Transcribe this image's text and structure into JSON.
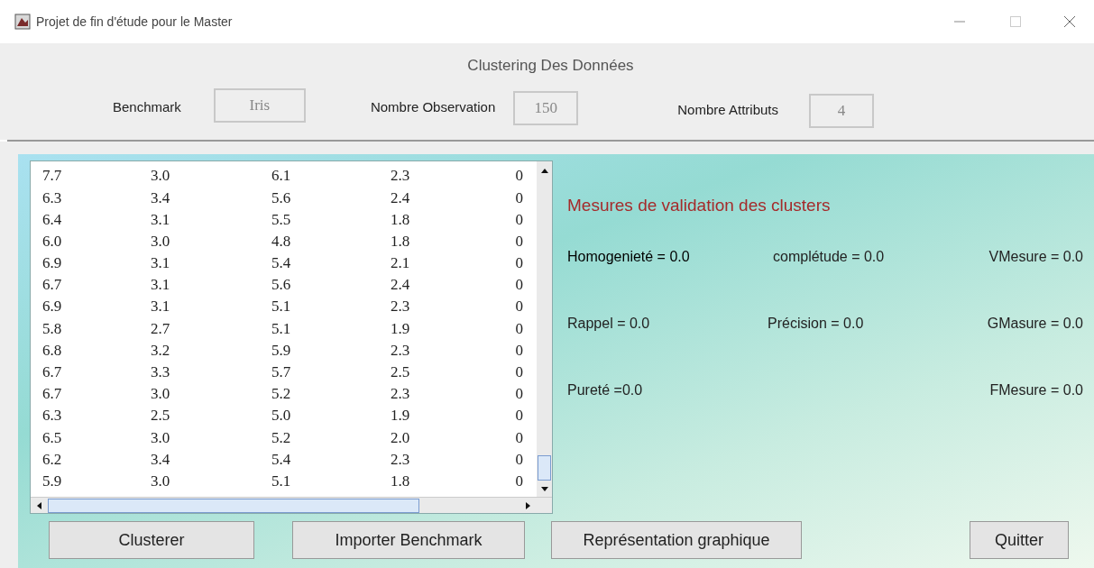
{
  "window": {
    "title": "Projet de fin d'étude pour le Master"
  },
  "header": {
    "title": "Clustering Des Données",
    "fields": [
      {
        "label": "Benchmark",
        "value": "Iris"
      },
      {
        "label": "Nombre Observation",
        "value": "150"
      },
      {
        "label": "Nombre Attributs",
        "value": "4"
      }
    ]
  },
  "table": {
    "rows": [
      [
        "7.7",
        "3.0",
        "6.1",
        "2.3",
        "0"
      ],
      [
        "6.3",
        "3.4",
        "5.6",
        "2.4",
        "0"
      ],
      [
        "6.4",
        "3.1",
        "5.5",
        "1.8",
        "0"
      ],
      [
        "6.0",
        "3.0",
        "4.8",
        "1.8",
        "0"
      ],
      [
        "6.9",
        "3.1",
        "5.4",
        "2.1",
        "0"
      ],
      [
        "6.7",
        "3.1",
        "5.6",
        "2.4",
        "0"
      ],
      [
        "6.9",
        "3.1",
        "5.1",
        "2.3",
        "0"
      ],
      [
        "5.8",
        "2.7",
        "5.1",
        "1.9",
        "0"
      ],
      [
        "6.8",
        "3.2",
        "5.9",
        "2.3",
        "0"
      ],
      [
        "6.7",
        "3.3",
        "5.7",
        "2.5",
        "0"
      ],
      [
        "6.7",
        "3.0",
        "5.2",
        "2.3",
        "0"
      ],
      [
        "6.3",
        "2.5",
        "5.0",
        "1.9",
        "0"
      ],
      [
        "6.5",
        "3.0",
        "5.2",
        "2.0",
        "0"
      ],
      [
        "6.2",
        "3.4",
        "5.4",
        "2.3",
        "0"
      ],
      [
        "5.9",
        "3.0",
        "5.1",
        "1.8",
        "0"
      ]
    ]
  },
  "measures": {
    "title": "Mesures de validation des clusters",
    "rows": [
      {
        "left": "Homogenieté = 0.0",
        "center": "complétude = 0.0",
        "right": "VMesure = 0.0"
      },
      {
        "left": "Rappel = 0.0",
        "center": "Précision = 0.0",
        "right": "GMasure = 0.0"
      },
      {
        "left": "Pureté =0.0",
        "right": "FMesure = 0.0"
      }
    ]
  },
  "buttons": [
    "Clusterer",
    "Importer Benchmark",
    "Représentation graphique",
    "Quitter"
  ]
}
